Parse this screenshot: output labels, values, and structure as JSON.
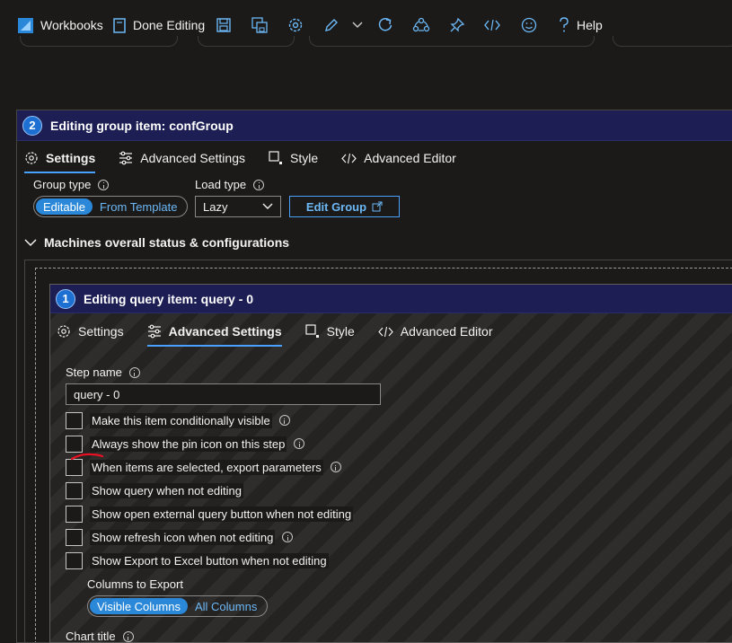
{
  "toolbar": {
    "workbooks_label": "Workbooks",
    "done_editing_label": "Done Editing",
    "help_label": "Help",
    "accent": "#2b88d8"
  },
  "group_item": {
    "step_number": "2",
    "title": "Editing group item: confGroup",
    "tabs": [
      {
        "label": "Settings",
        "active": true
      },
      {
        "label": "Advanced Settings",
        "active": false
      },
      {
        "label": "Style",
        "active": false
      },
      {
        "label": "Advanced Editor",
        "active": false
      }
    ],
    "group_type_label": "Group type",
    "group_type_options": [
      "Editable",
      "From Template"
    ],
    "group_type_selected": "Editable",
    "load_type_label": "Load type",
    "load_type_value": "Lazy",
    "edit_group_label": "Edit Group",
    "section_title": "Machines overall status & configurations"
  },
  "query_item": {
    "step_number": "1",
    "title": "Editing query item: query - 0",
    "tabs": [
      {
        "label": "Settings",
        "active": false
      },
      {
        "label": "Advanced Settings",
        "active": true
      },
      {
        "label": "Style",
        "active": false
      },
      {
        "label": "Advanced Editor",
        "active": false
      }
    ],
    "step_name_label": "Step name",
    "step_name_value": "query - 0",
    "checkboxes": [
      {
        "label": "Make this item conditionally visible",
        "info": true,
        "checked": false
      },
      {
        "label": "Always show the pin icon on this step",
        "info": true,
        "checked": false
      },
      {
        "label": "When items are selected, export parameters",
        "info": true,
        "checked": false
      },
      {
        "label": "Show query when not editing",
        "info": false,
        "checked": false
      },
      {
        "label": "Show open external query button when not editing",
        "info": false,
        "checked": false
      },
      {
        "label": "Show refresh icon when not editing",
        "info": true,
        "checked": false
      },
      {
        "label": "Show Export to Excel button when not editing",
        "info": false,
        "checked": false
      }
    ],
    "columns_to_export_label": "Columns to Export",
    "columns_options": [
      "Visible Columns",
      "All Columns"
    ],
    "columns_selected": "Visible Columns",
    "chart_title_label": "Chart title"
  }
}
